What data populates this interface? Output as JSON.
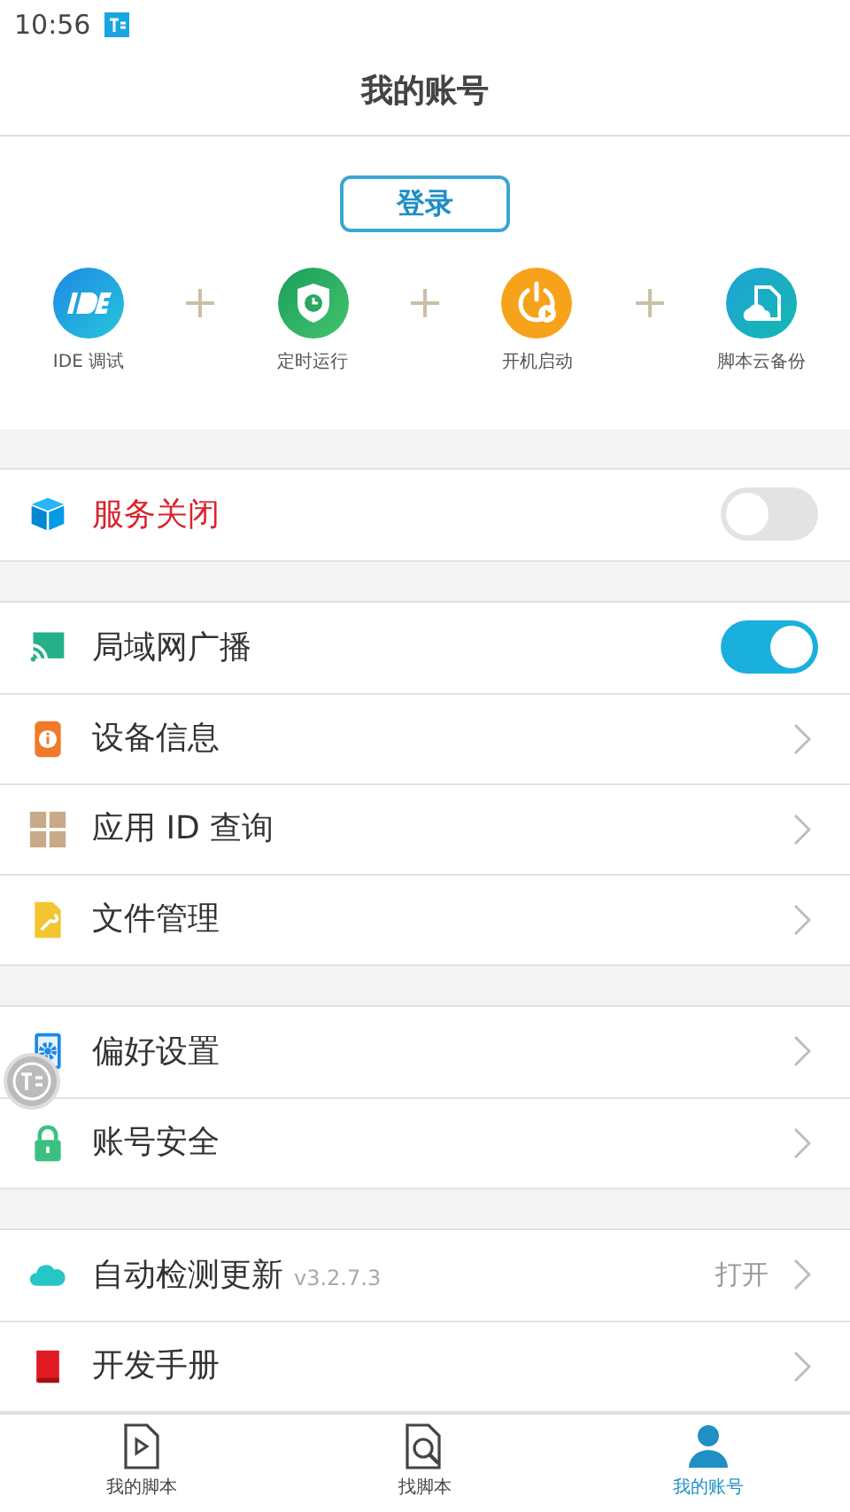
{
  "status_bar": {
    "time": "10:56"
  },
  "header": {
    "title": "我的账号"
  },
  "login_button": "登录",
  "features": [
    {
      "label": "IDE 调试"
    },
    {
      "label": "定时运行"
    },
    {
      "label": "开机启动"
    },
    {
      "label": "脚本云备份"
    }
  ],
  "sections": [
    {
      "rows": [
        {
          "kind": "toggle",
          "label": "服务关闭",
          "alert": true,
          "on": false
        }
      ]
    },
    {
      "rows": [
        {
          "kind": "toggle",
          "label": "局域网广播",
          "alert": false,
          "on": true
        },
        {
          "kind": "link",
          "label": "设备信息",
          "alert": false
        },
        {
          "kind": "link",
          "label": "应用 ID 查询",
          "alert": false
        },
        {
          "kind": "link",
          "label": "文件管理",
          "alert": false
        }
      ]
    },
    {
      "rows": [
        {
          "kind": "link",
          "label": "偏好设置",
          "alert": false
        },
        {
          "kind": "link",
          "label": "账号安全",
          "alert": false
        }
      ]
    },
    {
      "rows": [
        {
          "kind": "link",
          "label": "自动检测更新",
          "alert": false,
          "version": "v3.2.7.3",
          "value": "打开"
        },
        {
          "kind": "link",
          "label": "开发手册",
          "alert": false
        }
      ]
    }
  ],
  "tabs": [
    {
      "label": "我的脚本",
      "selected": false
    },
    {
      "label": "找脚本",
      "selected": false
    },
    {
      "label": "我的账号",
      "selected": true
    }
  ]
}
